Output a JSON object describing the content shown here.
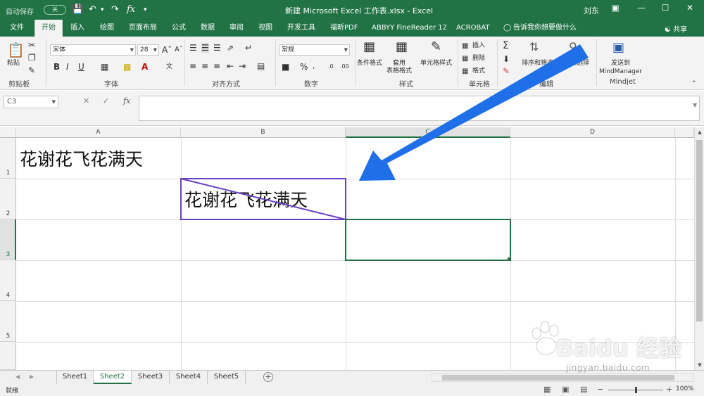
{
  "titlebar": {
    "autosave_label": "自动保存",
    "autosave_state": "关",
    "doc_title": "新建 Microsoft Excel 工作表.xlsx  -  Excel",
    "user": "刘东"
  },
  "tabs": [
    "文件",
    "开始",
    "插入",
    "绘图",
    "页面布局",
    "公式",
    "数据",
    "审阅",
    "视图",
    "开发工具",
    "福昕PDF",
    "ABBYY FineReader 12",
    "ACROBAT"
  ],
  "active_tab": "开始",
  "tell_me": "告诉我你想要做什么",
  "share": "共享",
  "ribbon": {
    "paste": "粘贴",
    "font_name": "宋体",
    "font_size": "28",
    "number_format": "常规",
    "conditional_format": "条件格式",
    "format_table": "套用\n表格格式",
    "cell_styles": "单元格样式",
    "insert": "插入",
    "delete": "删除",
    "format": "格式",
    "sort_filter": "排序和筛选",
    "find_select": "查找和选择",
    "send_to": "发送到",
    "mindmanager": "MindManager",
    "groups": {
      "clipboard": "剪贴板",
      "font": "字体",
      "alignment": "对齐方式",
      "number": "数字",
      "styles": "样式",
      "cells": "单元格",
      "editing": "编辑",
      "mindjet": "Mindjet"
    }
  },
  "formula_bar": {
    "name_box": "C3",
    "formula": ""
  },
  "columns": [
    "A",
    "B",
    "C",
    "D"
  ],
  "rows": [
    "1",
    "2",
    "3",
    "4",
    "5"
  ],
  "selected_cell": "C3",
  "cells": {
    "A1": "花谢花飞花满天",
    "B2": "花谢花飞花满天"
  },
  "sheets": [
    "Sheet1",
    "Sheet2",
    "Sheet3",
    "Sheet4",
    "Sheet5"
  ],
  "active_sheet": "Sheet2",
  "status": {
    "ready": "就绪",
    "zoom": "100%"
  },
  "annotation_color": "#6a3fc8",
  "arrow_color": "#1f6fe8",
  "accent_color": "#217346",
  "watermark": {
    "brand": "Baidu 经验",
    "url": "jingyan.baidu.com"
  }
}
